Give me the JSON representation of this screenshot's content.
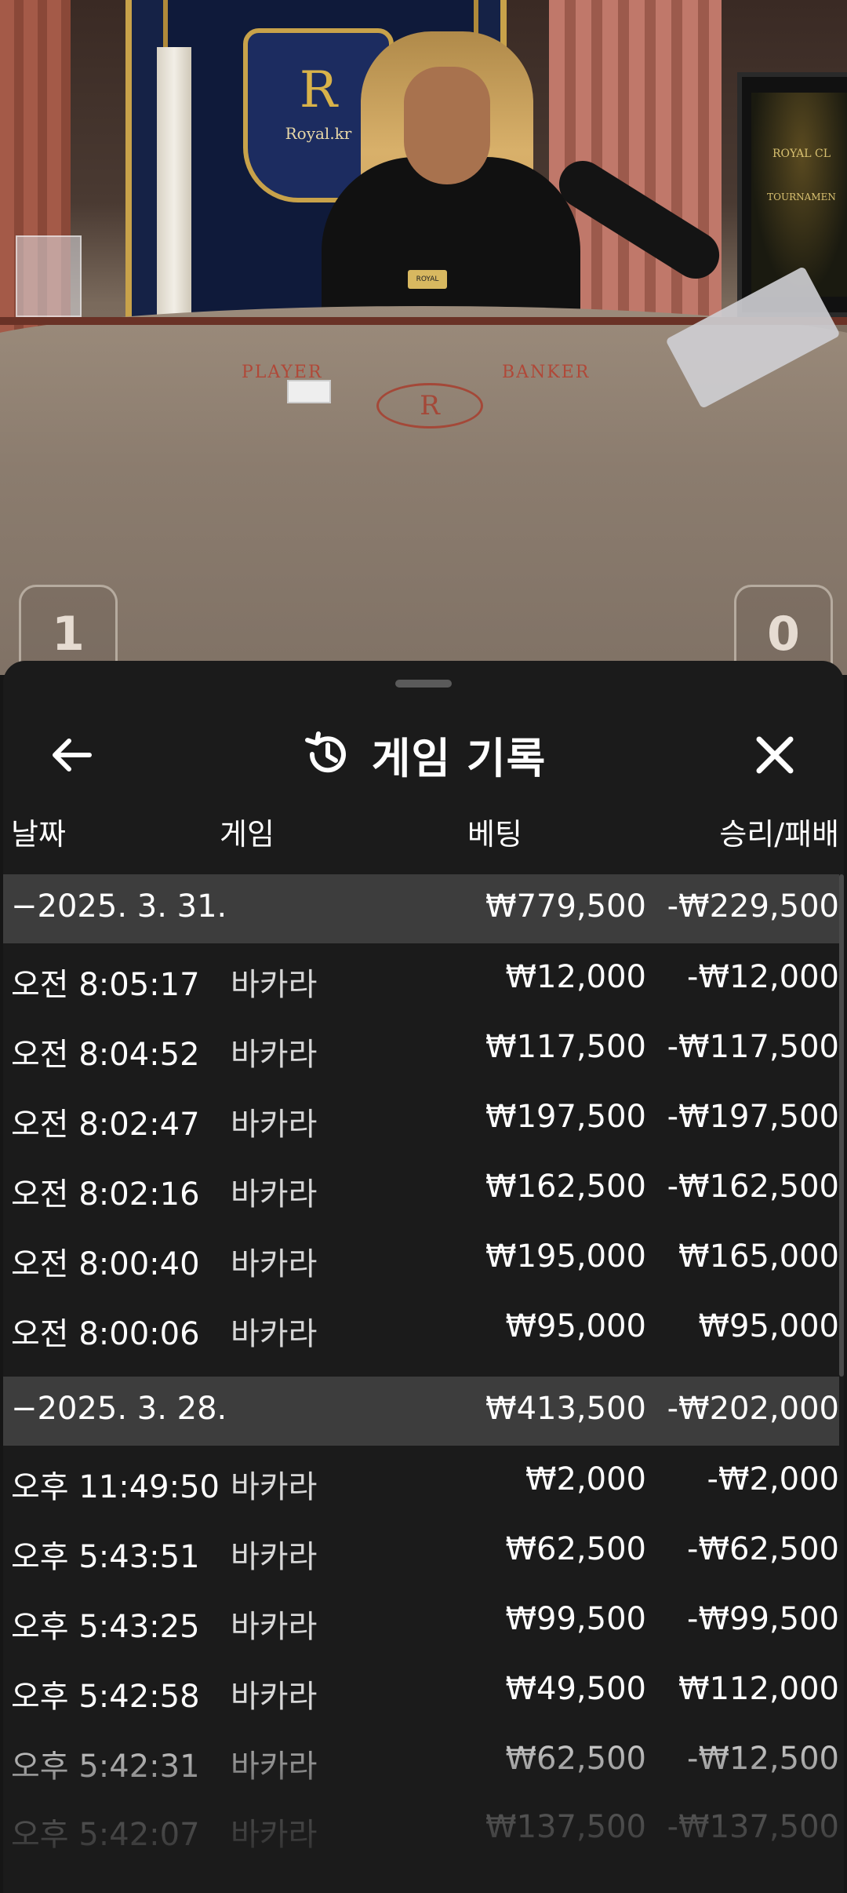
{
  "background": {
    "shield_letter": "R",
    "shield_text": "Royal.kr",
    "monitor_text": "ROYAL CL",
    "monitor_sub": "TOURNAMEN",
    "table_player_label": "PLAYER",
    "table_banker_label": "BANKER",
    "table_logo_letter": "R",
    "name_tag": "ROYAL",
    "score_left": "1",
    "score_right": "0"
  },
  "sheet": {
    "title": "게임 기록",
    "columns": {
      "date": "날짜",
      "game": "게임",
      "bet": "베팅",
      "result": "승리/패배"
    },
    "groups": [
      {
        "day": "−2025. 3. 31.",
        "total_bet": "₩779,500",
        "total_result": "-₩229,500",
        "rows": [
          {
            "time": "오전 8:05:17",
            "game": "바카라",
            "bet": "₩12,000",
            "result": "-₩12,000"
          },
          {
            "time": "오전 8:04:52",
            "game": "바카라",
            "bet": "₩117,500",
            "result": "-₩117,500"
          },
          {
            "time": "오전 8:02:47",
            "game": "바카라",
            "bet": "₩197,500",
            "result": "-₩197,500"
          },
          {
            "time": "오전 8:02:16",
            "game": "바카라",
            "bet": "₩162,500",
            "result": "-₩162,500"
          },
          {
            "time": "오전 8:00:40",
            "game": "바카라",
            "bet": "₩195,000",
            "result": "₩165,000"
          },
          {
            "time": "오전 8:00:06",
            "game": "바카라",
            "bet": "₩95,000",
            "result": "₩95,000"
          }
        ]
      },
      {
        "day": "−2025. 3. 28.",
        "total_bet": "₩413,500",
        "total_result": "-₩202,000",
        "rows": [
          {
            "time": "오후 11:49:50",
            "game": "바카라",
            "bet": "₩2,000",
            "result": "-₩2,000"
          },
          {
            "time": "오후 5:43:51",
            "game": "바카라",
            "bet": "₩62,500",
            "result": "-₩62,500"
          },
          {
            "time": "오후 5:43:25",
            "game": "바카라",
            "bet": "₩99,500",
            "result": "-₩99,500"
          },
          {
            "time": "오후 5:42:58",
            "game": "바카라",
            "bet": "₩49,500",
            "result": "₩112,000"
          },
          {
            "time": "오후 5:42:31",
            "game": "바카라",
            "bet": "₩62,500",
            "result": "-₩12,500"
          },
          {
            "time": "오후 5:42:07",
            "game": "바카라",
            "bet": "₩137,500",
            "result": "-₩137,500"
          }
        ]
      }
    ]
  },
  "icons": {
    "back": "arrow-left-icon",
    "history": "history-icon",
    "close": "close-icon"
  }
}
